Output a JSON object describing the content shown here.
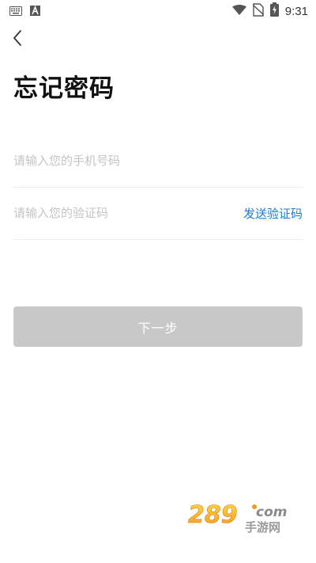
{
  "status_bar": {
    "time": "9:31",
    "icons": [
      "keyboard-icon",
      "a-notification-icon",
      "wifi-icon",
      "no-sim-icon",
      "battery-charging-icon"
    ]
  },
  "header": {
    "back_icon": "chevron-left-icon",
    "title": "忘记密码"
  },
  "form": {
    "phone_placeholder": "请输入您的手机号码",
    "phone_value": "",
    "code_placeholder": "请输入您的验证码",
    "code_value": "",
    "send_code_label": "发送验证码",
    "next_label": "下一步"
  },
  "watermark": {
    "text": "289.com 手游网"
  },
  "colors": {
    "accent": "#1a7bd4",
    "button_disabled": "#c8c8c8",
    "title": "#111111",
    "placeholder": "#c4c4c4",
    "divider": "#ececec"
  }
}
